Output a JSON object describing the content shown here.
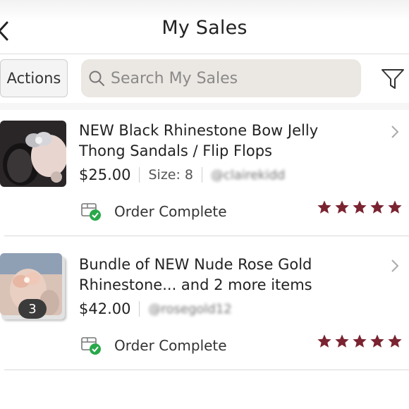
{
  "header": {
    "title": "My Sales"
  },
  "toolbar": {
    "actions_label": "Actions",
    "search_placeholder": "Search My Sales"
  },
  "colors": {
    "star": "#7a2431",
    "search_bg": "#ebe7e2",
    "status_check": "#2aa84a"
  },
  "sales": [
    {
      "title_line1": "NEW Black Rhinestone Bow Jelly",
      "title_line2": "Thong Sandals / Flip Flops",
      "price": "$25.00",
      "size": "Size: 8",
      "buyer": "@clairekidd",
      "status": "Order Complete",
      "rating": 5,
      "thumbnail_icon": "black-sandal-photo"
    },
    {
      "title_line1": "Bundle of NEW Nude Rose Gold",
      "title_line2": "Rhinestone... and 2 more items",
      "price": "$42.00",
      "buyer": "@rosegold12",
      "bundle_count": "3",
      "status": "Order Complete",
      "rating": 5,
      "thumbnail_icon": "rose-gold-sandal-photo"
    }
  ]
}
